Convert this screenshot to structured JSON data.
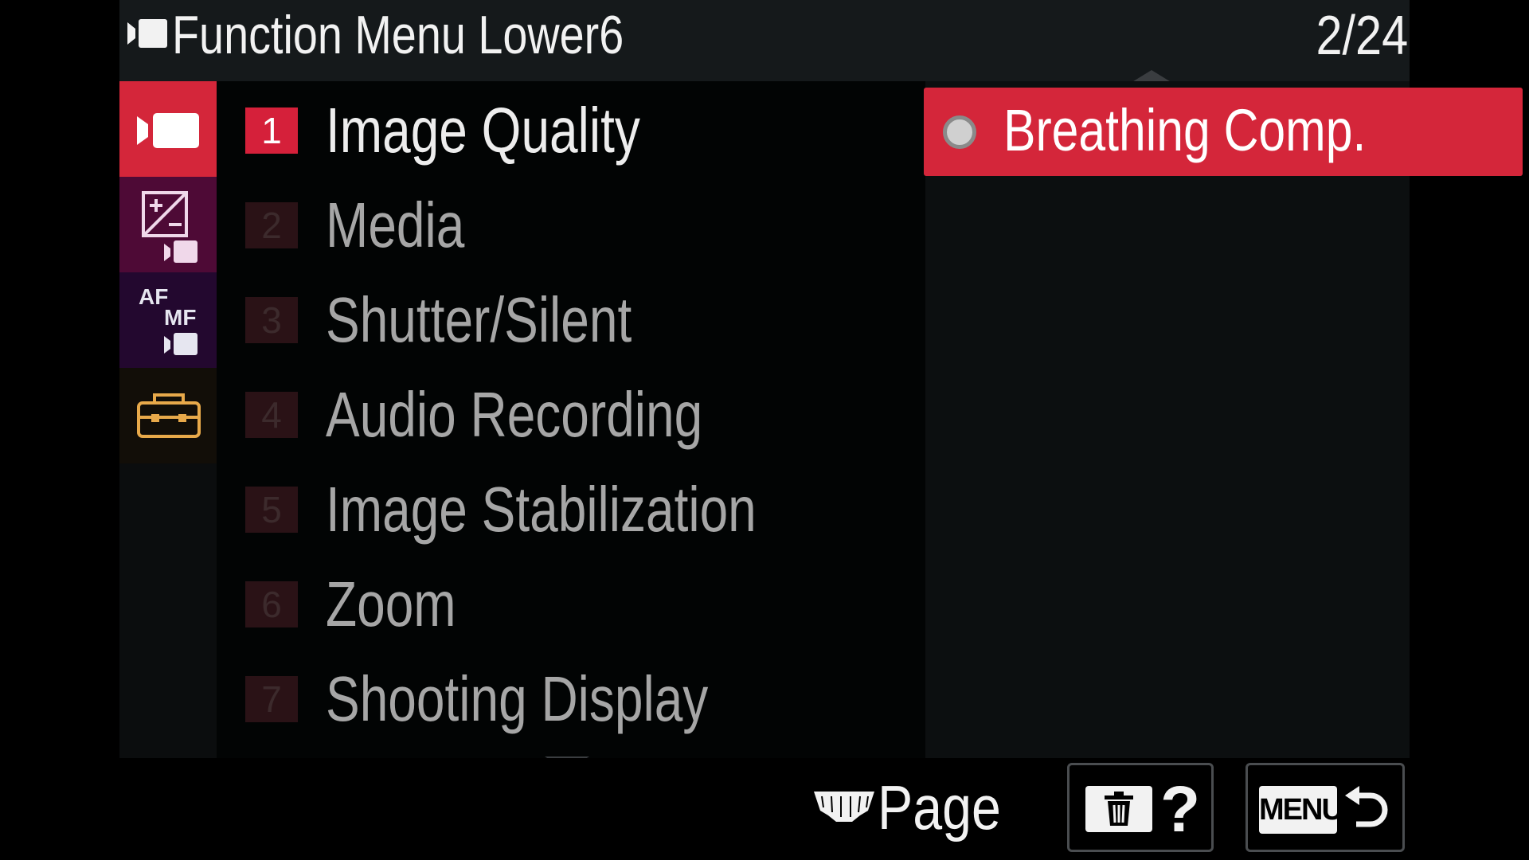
{
  "header": {
    "title": "Function Menu Lower6",
    "page_indicator": "2/24"
  },
  "category_tabs": [
    {
      "icon": "movie-camera-icon",
      "selected": true
    },
    {
      "icon": "exposure-movie-icon",
      "selected": false
    },
    {
      "icon": "af-mf-movie-icon",
      "selected": false
    },
    {
      "icon": "toolbox-icon",
      "selected": false
    }
  ],
  "menu_items": [
    {
      "number": "1",
      "label": "Image Quality",
      "active": true
    },
    {
      "number": "2",
      "label": "Media",
      "active": false
    },
    {
      "number": "3",
      "label": "Shutter/Silent",
      "active": false
    },
    {
      "number": "4",
      "label": "Audio Recording",
      "active": false
    },
    {
      "number": "5",
      "label": "Image Stabilization",
      "active": false
    },
    {
      "number": "6",
      "label": "Zoom",
      "active": false
    },
    {
      "number": "7",
      "label": "Shooting Display",
      "active": false
    }
  ],
  "sub_items": [
    {
      "label": "Breathing Comp.",
      "selected": true
    }
  ],
  "footer": {
    "page_label": "Page",
    "help_label": "?",
    "menu_label": "MENU"
  },
  "colors": {
    "accent": "#d4263a",
    "header_bg": "#15191b",
    "exposure_tab": "#5a0a3c",
    "af_tab": "#2a0838",
    "setup_icon": "#e8a94a"
  }
}
